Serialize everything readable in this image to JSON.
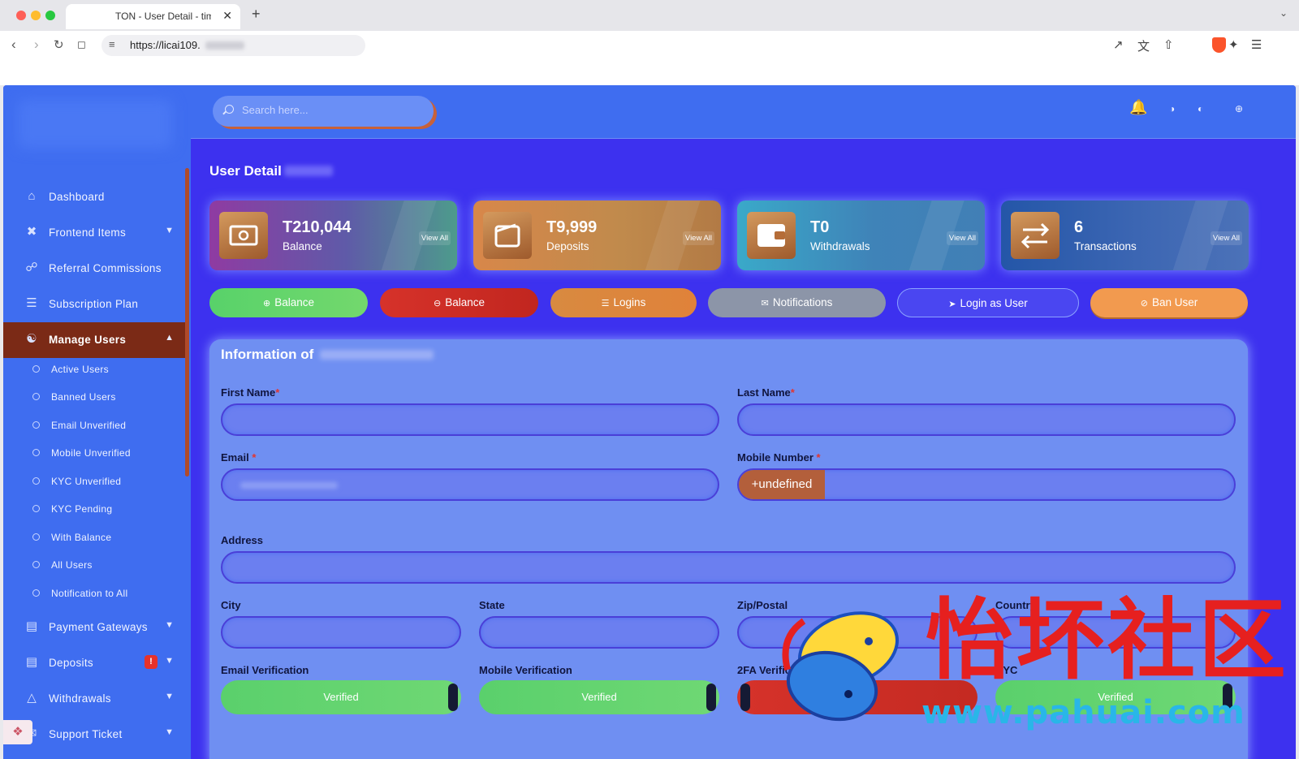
{
  "browser": {
    "tab_title": "TON - User Detail - timi",
    "tab_close": "✕",
    "new_tab": "+",
    "url": "https://licai109."
  },
  "sidebar": {
    "items": [
      {
        "label": "Dashboard",
        "icon": "home-icon"
      },
      {
        "label": "Frontend Items",
        "icon": "tools-icon"
      },
      {
        "label": "Referral Commissions",
        "icon": "link-icon"
      },
      {
        "label": "Subscription Plan",
        "icon": "list-icon"
      },
      {
        "label": "Manage Users",
        "icon": "users-icon"
      }
    ],
    "manage_users_sub": [
      "Active Users",
      "Banned Users",
      "Email Unverified",
      "Mobile Unverified",
      "KYC Unverified",
      "KYC Pending",
      "With Balance",
      "All Users",
      "Notification to All"
    ],
    "bottom_items": [
      {
        "label": "Payment Gateways",
        "icon": "card-icon"
      },
      {
        "label": "Deposits",
        "icon": "file-icon",
        "badge": "!"
      },
      {
        "label": "Withdrawals",
        "icon": "bank-icon"
      },
      {
        "label": "Support Ticket",
        "icon": "ticket-icon"
      }
    ]
  },
  "header": {
    "search_placeholder": "Search here..."
  },
  "page": {
    "title": "User Detail"
  },
  "stats": [
    {
      "value": "T210,044",
      "label": "Balance",
      "link": "View All",
      "icon": "money-icon"
    },
    {
      "value": "T9,999",
      "label": "Deposits",
      "link": "View All",
      "icon": "wallet-icon"
    },
    {
      "value": "T0",
      "label": "Withdrawals",
      "link": "View All",
      "icon": "wallet-icon"
    },
    {
      "value": "6",
      "label": "Transactions",
      "link": "View All",
      "icon": "exchange-icon"
    }
  ],
  "actions": {
    "add_balance": "Balance",
    "subtract_balance": "Balance",
    "logins": "Logins",
    "notifications": "Notifications",
    "login_as_user": "Login as User",
    "ban_user": "Ban User"
  },
  "info": {
    "title": "Information of",
    "first_name_label": "First Name",
    "last_name_label": "Last Name",
    "email_label": "Email",
    "mobile_label": "Mobile Number",
    "mobile_prefix": "+undefined",
    "address_label": "Address",
    "city_label": "City",
    "state_label": "State",
    "zip_label": "Zip/Postal",
    "country_label": "Country",
    "email_verification_label": "Email Verification",
    "mobile_verification_label": "Mobile Verification",
    "twofa_label": "2FA Verification",
    "kyc_label": "KYC",
    "required_mark": "*",
    "verified": "Verified"
  },
  "watermark": {
    "text": "怡坏社区",
    "url": "www.pahuai.com"
  },
  "colors": {
    "app_bg": "#3d31ef",
    "sidebar_bg": "#3f6df0",
    "active_item": "#7b2a16",
    "verified_green": "#5ad06c",
    "danger_red": "#d6322a"
  }
}
